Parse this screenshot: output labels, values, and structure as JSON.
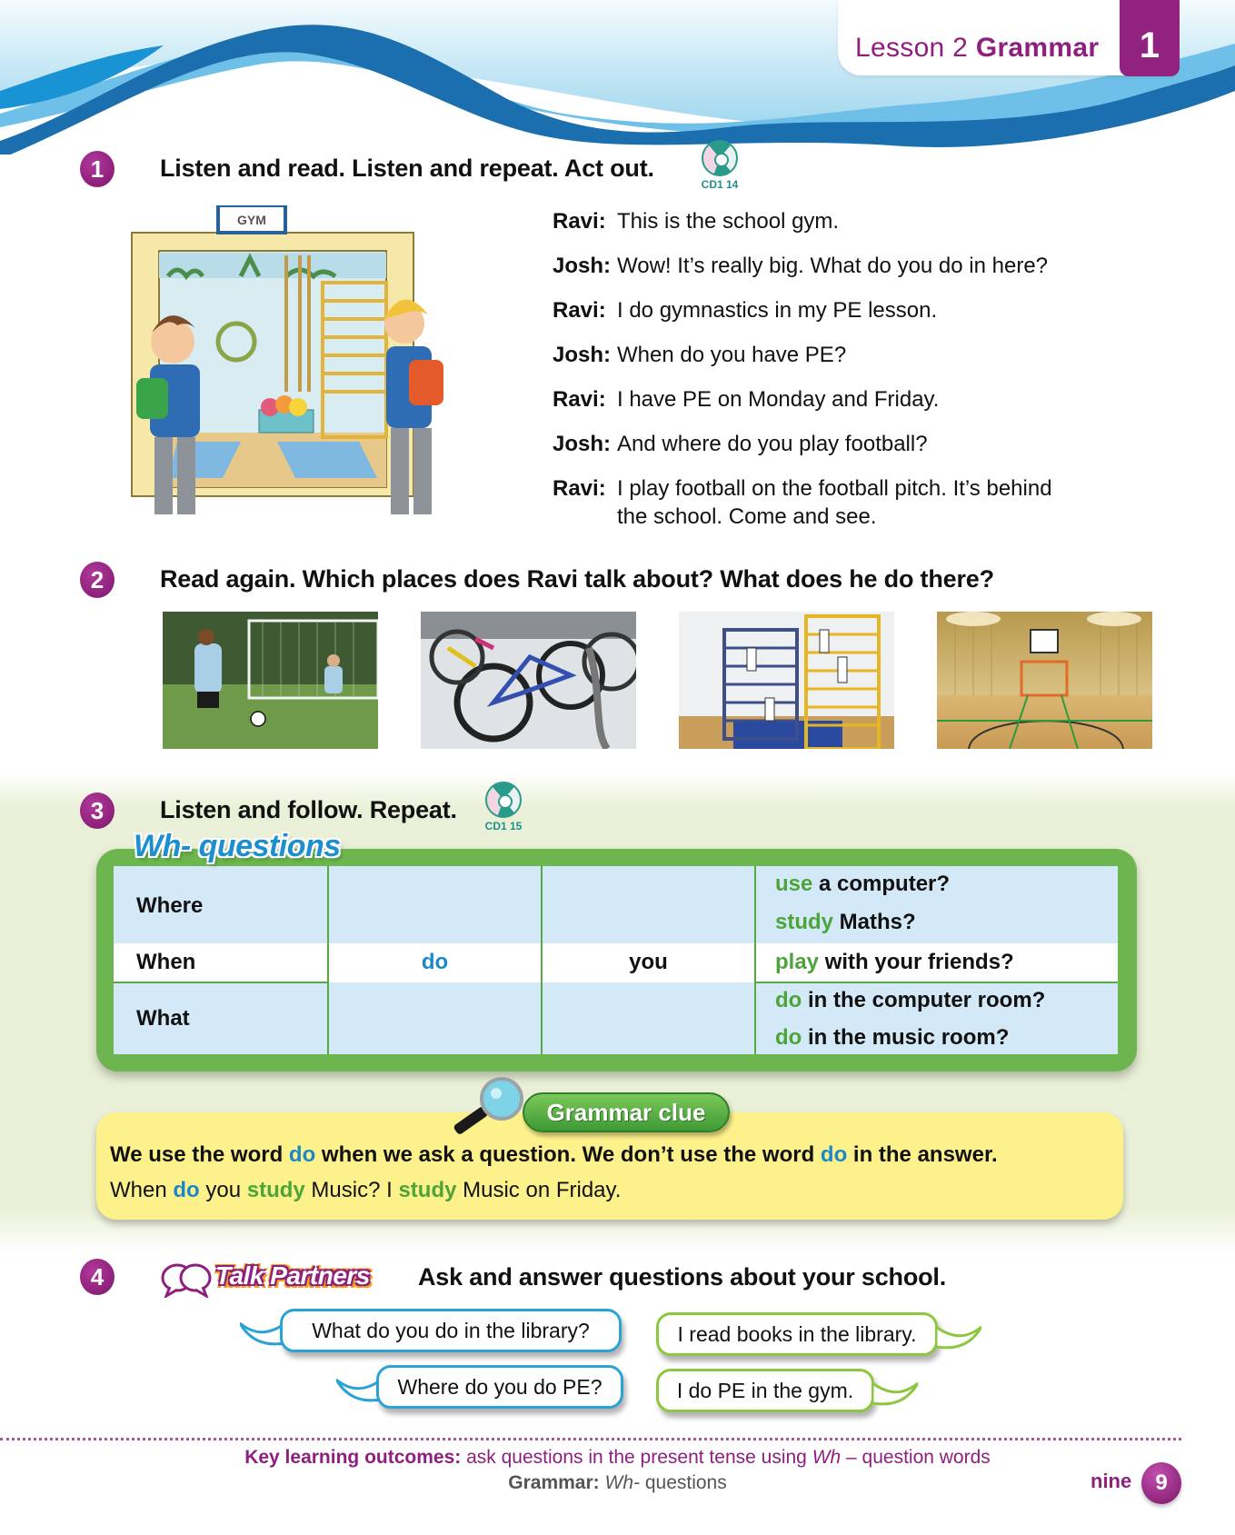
{
  "header": {
    "lesson_label": "Lesson 2",
    "lesson_type": "Grammar",
    "unit_number": "1"
  },
  "colors": {
    "brand_purple": "#8e1f7f",
    "wave_blue": "#1b6fae",
    "table_green": "#6db64f",
    "table_cell_blue": "#d4e9f7",
    "highlight_blue": "#1c87c9",
    "highlight_green": "#4da43a",
    "clue_yellow": "#fdf18b"
  },
  "exercise1": {
    "number": "1",
    "instruction": "Listen and read. Listen and repeat. Act out.",
    "cd_label": "CD1 14",
    "illustration_sign": "GYM",
    "dialogue": [
      {
        "speaker": "Ravi:",
        "text": "This is the school gym."
      },
      {
        "speaker": "Josh:",
        "text": "Wow! It’s really big. What do you do in here?"
      },
      {
        "speaker": "Ravi:",
        "text": "I do gymnastics in my PE lesson."
      },
      {
        "speaker": "Josh:",
        "text": "When do you have PE?"
      },
      {
        "speaker": "Ravi:",
        "text": "I have PE on Monday and Friday."
      },
      {
        "speaker": "Josh:",
        "text": "And where do you play football?"
      },
      {
        "speaker": "Ravi:",
        "text": "I play football on the football pitch. It’s behind",
        "text2": "the school. Come and see."
      }
    ]
  },
  "exercise2": {
    "number": "2",
    "instruction": "Read again. Which places does Ravi talk about? What does he do there?",
    "photos": [
      {
        "subject": "football-pitch"
      },
      {
        "subject": "bike-rack"
      },
      {
        "subject": "gym-climbing-frames"
      },
      {
        "subject": "sports-hall"
      }
    ]
  },
  "exercise3": {
    "number": "3",
    "instruction": "Listen and follow. Repeat.",
    "cd_label": "CD1 15",
    "table_title": "Wh- questions",
    "question_words": [
      "Where",
      "When",
      "What"
    ],
    "auxiliary": "do",
    "subject": "you",
    "endings": [
      {
        "verb": "use",
        "rest": " a computer?"
      },
      {
        "verb": "study",
        "rest": " Maths?"
      },
      {
        "verb": "play",
        "rest": " with your friends?"
      },
      {
        "verb": "do",
        "rest": " in the computer room?"
      },
      {
        "verb": "do",
        "rest": " in the music room?"
      }
    ],
    "grammar_clue": {
      "badge": "Grammar clue",
      "line1": [
        {
          "t": "We use the word ",
          "c": ""
        },
        {
          "t": "do",
          "c": "blue"
        },
        {
          "t": " when we ask a question. We don’t use the word ",
          "c": ""
        },
        {
          "t": "do",
          "c": "blue"
        },
        {
          "t": " in the answer.",
          "c": ""
        }
      ],
      "line2": [
        {
          "t": "When ",
          "c": ""
        },
        {
          "t": "do",
          "c": "blue"
        },
        {
          "t": " you ",
          "c": ""
        },
        {
          "t": "study",
          "c": "green"
        },
        {
          "t": " Music? I ",
          "c": ""
        },
        {
          "t": "study",
          "c": "green"
        },
        {
          "t": " Music on Friday.",
          "c": ""
        }
      ]
    }
  },
  "exercise4": {
    "number": "4",
    "badge": "Talk Partners",
    "instruction": "Ask and answer questions about your school.",
    "bubbles": [
      {
        "role": "question",
        "text": "What do you do in the library?"
      },
      {
        "role": "answer",
        "text": "I read books in the library."
      },
      {
        "role": "question",
        "text": "Where do you do PE?"
      },
      {
        "role": "answer",
        "text": "I do PE in the gym."
      }
    ]
  },
  "footer": {
    "outcomes_label": "Key learning outcomes:",
    "outcomes_text_before": " ask questions in the present tense using ",
    "outcomes_italic": "Wh",
    "outcomes_text_after": " – question words",
    "grammar_label": "Grammar:",
    "grammar_italic": "Wh-",
    "grammar_text": " questions",
    "page_word": "nine",
    "page_number": "9"
  }
}
